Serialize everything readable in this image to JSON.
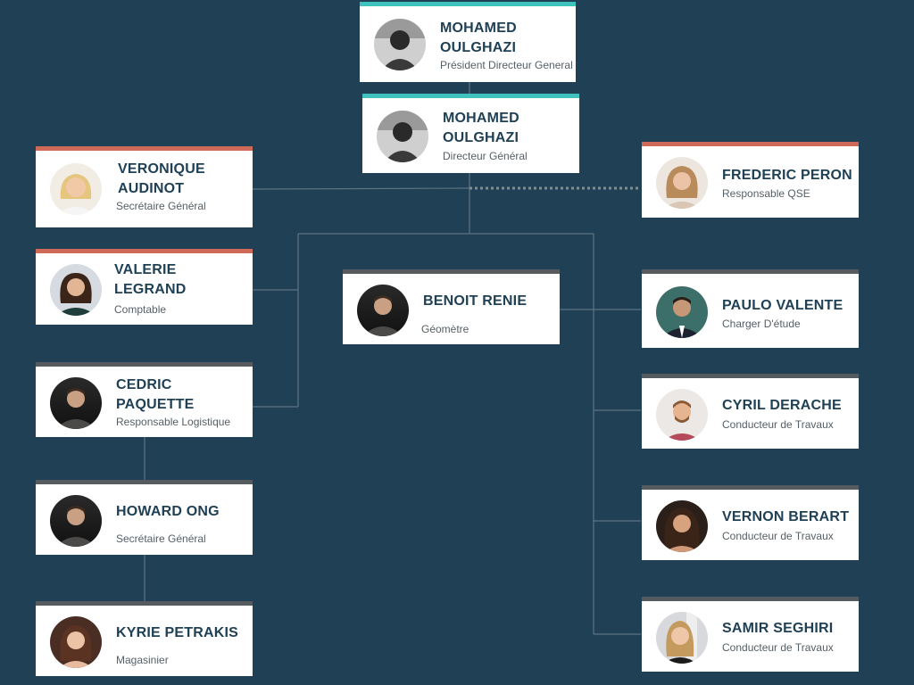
{
  "palette": {
    "background": "#1f4055",
    "card": "#ffffff",
    "name_text": "#1f4055",
    "accent_teal": "#3fc2bd",
    "accent_coral": "#cf6a58",
    "accent_gray": "#555b5e",
    "connector": "#5d7482"
  },
  "org": {
    "president": {
      "name": "MOHAMED OULGHAZI",
      "role": "Président Directeur General",
      "photo": "avatar-photo"
    },
    "director": {
      "name": "MOHAMED OULGHAZI",
      "role": "Directeur Général",
      "photo": "avatar-photo"
    },
    "veronique": {
      "name": "VERONIQUE AUDINOT",
      "role": "Secrétaire Général",
      "photo": "avatar-photo"
    },
    "valerie": {
      "name": "VALERIE LEGRAND",
      "role": "Comptable",
      "photo": "avatar-photo"
    },
    "cedric": {
      "name": "CEDRIC PAQUETTE",
      "role": "Responsable Logistique",
      "photo": "avatar-photo"
    },
    "howard": {
      "name": "HOWARD ONG",
      "role": "Secrétaire Général",
      "photo": "avatar-photo"
    },
    "kyrie": {
      "name": "KYRIE PETRAKIS",
      "role": "Magasinier",
      "photo": "avatar-photo"
    },
    "benoit": {
      "name": "BENOIT RENIE",
      "role": "Géomètre",
      "photo": "avatar-photo"
    },
    "frederic": {
      "name": "FREDERIC PERON",
      "role": "Responsable QSE",
      "photo": "avatar-photo"
    },
    "paulo": {
      "name": "PAULO VALENTE",
      "role": "Charger D'étude",
      "photo": "avatar-photo"
    },
    "cyril": {
      "name": "CYRIL DERACHE",
      "role": "Conducteur de Travaux",
      "photo": "avatar-photo"
    },
    "vernon": {
      "name": "VERNON BERART",
      "role": "Conducteur de Travaux",
      "photo": "avatar-photo"
    },
    "samir": {
      "name": "SAMIR SEGHIRI",
      "role": "Conducteur de Travaux",
      "photo": "avatar-photo"
    }
  }
}
